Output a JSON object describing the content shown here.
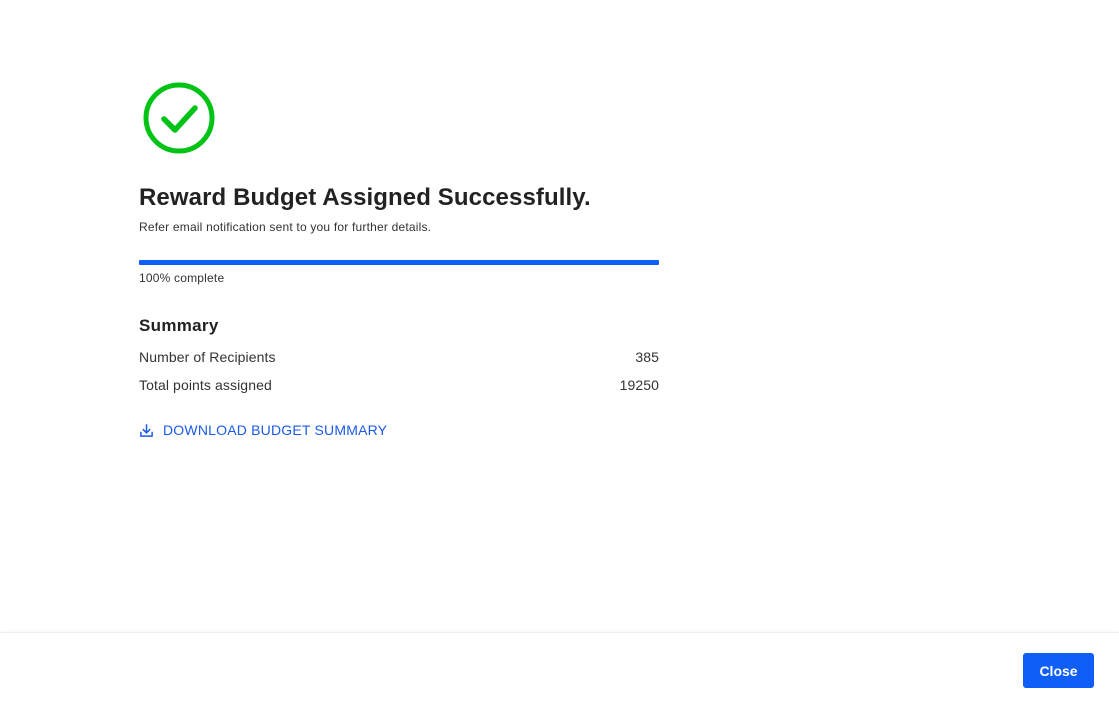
{
  "status": {
    "icon": "check-circle-icon",
    "color": "#00c316"
  },
  "header": {
    "title": "Reward Budget Assigned Successfully.",
    "subtitle": "Refer email notification sent to you for further details."
  },
  "progress": {
    "percent": 100,
    "label": "100% complete",
    "color": "#0f5ef7"
  },
  "summary": {
    "heading": "Summary",
    "rows": [
      {
        "label": "Number of Recipients",
        "value": "385"
      },
      {
        "label": "Total points assigned",
        "value": "19250"
      }
    ]
  },
  "download": {
    "icon": "download-icon",
    "label": "DOWNLOAD BUDGET SUMMARY"
  },
  "footer": {
    "close_label": "Close"
  }
}
